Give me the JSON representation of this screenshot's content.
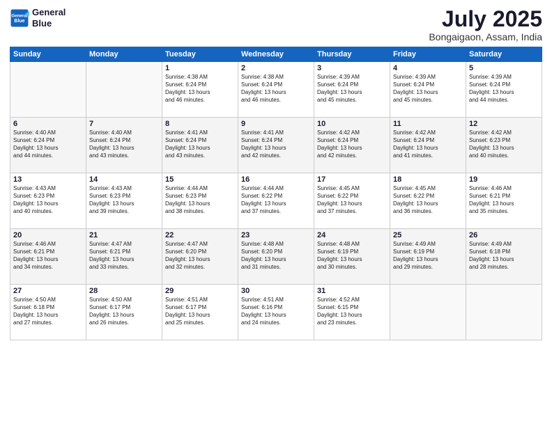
{
  "header": {
    "logo_line1": "General",
    "logo_line2": "Blue",
    "month": "July 2025",
    "location": "Bongaigaon, Assam, India"
  },
  "weekdays": [
    "Sunday",
    "Monday",
    "Tuesday",
    "Wednesday",
    "Thursday",
    "Friday",
    "Saturday"
  ],
  "rows": [
    {
      "shaded": false,
      "cells": [
        {
          "day": "",
          "info": ""
        },
        {
          "day": "",
          "info": ""
        },
        {
          "day": "1",
          "info": "Sunrise: 4:38 AM\nSunset: 6:24 PM\nDaylight: 13 hours\nand 46 minutes."
        },
        {
          "day": "2",
          "info": "Sunrise: 4:38 AM\nSunset: 6:24 PM\nDaylight: 13 hours\nand 46 minutes."
        },
        {
          "day": "3",
          "info": "Sunrise: 4:39 AM\nSunset: 6:24 PM\nDaylight: 13 hours\nand 45 minutes."
        },
        {
          "day": "4",
          "info": "Sunrise: 4:39 AM\nSunset: 6:24 PM\nDaylight: 13 hours\nand 45 minutes."
        },
        {
          "day": "5",
          "info": "Sunrise: 4:39 AM\nSunset: 6:24 PM\nDaylight: 13 hours\nand 44 minutes."
        }
      ]
    },
    {
      "shaded": true,
      "cells": [
        {
          "day": "6",
          "info": "Sunrise: 4:40 AM\nSunset: 6:24 PM\nDaylight: 13 hours\nand 44 minutes."
        },
        {
          "day": "7",
          "info": "Sunrise: 4:40 AM\nSunset: 6:24 PM\nDaylight: 13 hours\nand 43 minutes."
        },
        {
          "day": "8",
          "info": "Sunrise: 4:41 AM\nSunset: 6:24 PM\nDaylight: 13 hours\nand 43 minutes."
        },
        {
          "day": "9",
          "info": "Sunrise: 4:41 AM\nSunset: 6:24 PM\nDaylight: 13 hours\nand 42 minutes."
        },
        {
          "day": "10",
          "info": "Sunrise: 4:42 AM\nSunset: 6:24 PM\nDaylight: 13 hours\nand 42 minutes."
        },
        {
          "day": "11",
          "info": "Sunrise: 4:42 AM\nSunset: 6:24 PM\nDaylight: 13 hours\nand 41 minutes."
        },
        {
          "day": "12",
          "info": "Sunrise: 4:42 AM\nSunset: 6:23 PM\nDaylight: 13 hours\nand 40 minutes."
        }
      ]
    },
    {
      "shaded": false,
      "cells": [
        {
          "day": "13",
          "info": "Sunrise: 4:43 AM\nSunset: 6:23 PM\nDaylight: 13 hours\nand 40 minutes."
        },
        {
          "day": "14",
          "info": "Sunrise: 4:43 AM\nSunset: 6:23 PM\nDaylight: 13 hours\nand 39 minutes."
        },
        {
          "day": "15",
          "info": "Sunrise: 4:44 AM\nSunset: 6:23 PM\nDaylight: 13 hours\nand 38 minutes."
        },
        {
          "day": "16",
          "info": "Sunrise: 4:44 AM\nSunset: 6:22 PM\nDaylight: 13 hours\nand 37 minutes."
        },
        {
          "day": "17",
          "info": "Sunrise: 4:45 AM\nSunset: 6:22 PM\nDaylight: 13 hours\nand 37 minutes."
        },
        {
          "day": "18",
          "info": "Sunrise: 4:45 AM\nSunset: 6:22 PM\nDaylight: 13 hours\nand 36 minutes."
        },
        {
          "day": "19",
          "info": "Sunrise: 4:46 AM\nSunset: 6:21 PM\nDaylight: 13 hours\nand 35 minutes."
        }
      ]
    },
    {
      "shaded": true,
      "cells": [
        {
          "day": "20",
          "info": "Sunrise: 4:46 AM\nSunset: 6:21 PM\nDaylight: 13 hours\nand 34 minutes."
        },
        {
          "day": "21",
          "info": "Sunrise: 4:47 AM\nSunset: 6:21 PM\nDaylight: 13 hours\nand 33 minutes."
        },
        {
          "day": "22",
          "info": "Sunrise: 4:47 AM\nSunset: 6:20 PM\nDaylight: 13 hours\nand 32 minutes."
        },
        {
          "day": "23",
          "info": "Sunrise: 4:48 AM\nSunset: 6:20 PM\nDaylight: 13 hours\nand 31 minutes."
        },
        {
          "day": "24",
          "info": "Sunrise: 4:48 AM\nSunset: 6:19 PM\nDaylight: 13 hours\nand 30 minutes."
        },
        {
          "day": "25",
          "info": "Sunrise: 4:49 AM\nSunset: 6:19 PM\nDaylight: 13 hours\nand 29 minutes."
        },
        {
          "day": "26",
          "info": "Sunrise: 4:49 AM\nSunset: 6:18 PM\nDaylight: 13 hours\nand 28 minutes."
        }
      ]
    },
    {
      "shaded": false,
      "cells": [
        {
          "day": "27",
          "info": "Sunrise: 4:50 AM\nSunset: 6:18 PM\nDaylight: 13 hours\nand 27 minutes."
        },
        {
          "day": "28",
          "info": "Sunrise: 4:50 AM\nSunset: 6:17 PM\nDaylight: 13 hours\nand 26 minutes."
        },
        {
          "day": "29",
          "info": "Sunrise: 4:51 AM\nSunset: 6:17 PM\nDaylight: 13 hours\nand 25 minutes."
        },
        {
          "day": "30",
          "info": "Sunrise: 4:51 AM\nSunset: 6:16 PM\nDaylight: 13 hours\nand 24 minutes."
        },
        {
          "day": "31",
          "info": "Sunrise: 4:52 AM\nSunset: 6:15 PM\nDaylight: 13 hours\nand 23 minutes."
        },
        {
          "day": "",
          "info": ""
        },
        {
          "day": "",
          "info": ""
        }
      ]
    }
  ]
}
